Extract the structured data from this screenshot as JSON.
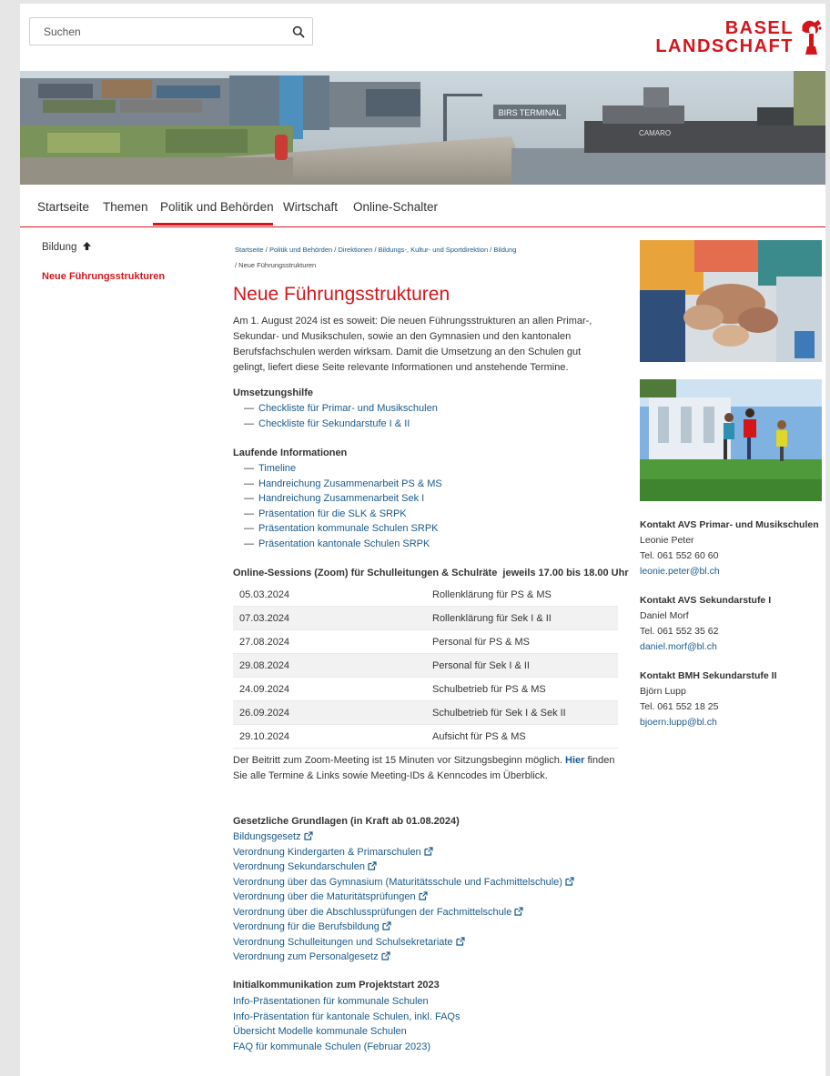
{
  "header": {
    "search_placeholder": "Suchen",
    "logo_line1": "BASEL",
    "logo_line2": "LANDSCHAFT"
  },
  "nav": {
    "items": [
      {
        "label": "Startseite"
      },
      {
        "label": "Themen"
      },
      {
        "label": "Politik und Behörden"
      },
      {
        "label": "Wirtschaft"
      },
      {
        "label": "Online-Schalter"
      }
    ],
    "active": "Politik und Behörden"
  },
  "leftnav": {
    "parent": "Bildung",
    "current": "Neue Führungsstrukturen"
  },
  "breadcrumb": {
    "items": [
      "Startseite",
      "Politik und Behörden",
      "Direktionen",
      "Bildungs-, Kultur- und Sportdirektion",
      "Bildung"
    ],
    "current": "/ Neue Führungsstrukturen"
  },
  "main": {
    "title": "Neue Führungsstrukturen",
    "intro": "Am 1. August 2024 ist es soweit: Die neuen Führungsstrukturen an allen Primar-, Sekundar- und Musikschulen, sowie an den Gymnasien und den kantonalen Berufsfachschulen werden wirksam. Damit die Umsetzung an den Schulen gut gelingt, liefert diese Seite relevante Informationen und anstehende Termine.",
    "umsetzung": {
      "heading": "Umsetzungshilfe",
      "links": [
        "Checkliste für Primar- und Musikschulen",
        "Checkliste für Sekundarstufe I & II"
      ]
    },
    "laufende": {
      "heading": "Laufende Informationen",
      "links": [
        "Timeline",
        "Handreichung Zusammenarbeit PS & MS",
        "Handreichung Zusammenarbeit Sek I",
        "Präsentation für die SLK & SRPK",
        "Präsentation kommunale Schulen SRPK",
        "Präsentation kantonale Schulen SRPK"
      ]
    },
    "sessions": {
      "heading": "Online-Sessions (Zoom) für Schulleitungen & Schulräte  jeweils 17.00 bis 18.00 Uhr",
      "rows": [
        {
          "date": "05.03.2024",
          "topic": "Rollenklärung für PS & MS"
        },
        {
          "date": "07.03.2024",
          "topic": "Rollenklärung für Sek I & II"
        },
        {
          "date": "27.08.2024",
          "topic": "Personal für PS & MS"
        },
        {
          "date": "29.08.2024",
          "topic": "Personal für Sek I & II"
        },
        {
          "date": "24.09.2024",
          "topic": "Schulbetrieb für PS & MS"
        },
        {
          "date": "26.09.2024",
          "topic": "Schulbetrieb für Sek I & Sek II"
        },
        {
          "date": "29.10.2024",
          "topic": "Aufsicht für PS & MS"
        }
      ]
    },
    "zoom_note": {
      "before": "Der Beitritt zum Zoom-Meeting ist 15 Minuten vor Sitzungsbeginn möglich. ",
      "link": "Hier",
      "after": " finden Sie alle Termine & Links sowie Meeting-IDs & Kenncodes im Überblick."
    },
    "gesetz": {
      "heading": "Gesetzliche Grundlagen (in Kraft ab 01.08.2024)",
      "links": [
        "Bildungsgesetz",
        "Verordnung Kindergarten & Primarschulen",
        "Verordnung Sekundarschulen",
        "Verordnung über das Gymnasium (Maturitätsschule und Fachmittelschule)",
        "Verordnung über die Maturitätsprüfungen",
        "Verordnung über die Abschlussprüfungen der Fachmittelschule",
        "Verordnung für die Berufsbildung",
        "Verordnung Schulleitungen und Schulsekretariate",
        "Verordnung zum Personalgesetz"
      ]
    },
    "initial": {
      "heading": "Initialkommunikation zum Projektstart 2023",
      "links": [
        "Info-Präsentationen für kommunale Schulen",
        "Info-Präsentation für kantonale Schulen, inkl. FAQs",
        "Übersicht Modelle kommunale Schulen",
        "FAQ für kommunale Schulen (Februar 2023)"
      ]
    }
  },
  "banner": {
    "sign": "BIRS TERMINAL",
    "ship": "CAMARO"
  },
  "contacts": [
    {
      "heading": "Kontakt AVS Primar- und Musikschulen",
      "name": "Leonie Peter",
      "tel": "Tel. 061 552 60 60",
      "email": "leonie.peter@bl.ch"
    },
    {
      "heading": "Kontakt AVS Sekundarstufe I",
      "name": "Daniel Morf",
      "tel": "Tel. 061 552 35 62",
      "email": "daniel.morf@bl.ch"
    },
    {
      "heading": "Kontakt BMH Sekundarstufe II",
      "name": "Björn Lupp",
      "tel": "Tel. 061 552 18 25",
      "email": "bjoern.lupp@bl.ch"
    }
  ],
  "colors": {
    "accent": "#d4161b",
    "link": "#1a5a8c"
  }
}
